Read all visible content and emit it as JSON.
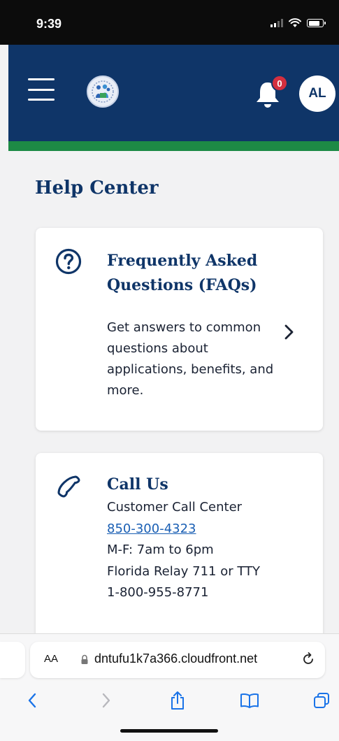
{
  "status_bar": {
    "time": "9:39"
  },
  "header": {
    "menu_icon": "hamburger-menu-icon",
    "logo_icon": "agency-seal-logo",
    "bell_icon": "bell-icon",
    "notification_count": "0",
    "avatar_initials": "AL",
    "colors": {
      "header": "#0f3568",
      "stripe": "#1d8a45",
      "badge": "#d32f3f"
    }
  },
  "page": {
    "title": "Help Center"
  },
  "faq_card": {
    "icon": "question-circle-icon",
    "title": "Frequently Asked Questions (FAQs)",
    "description": "Get answers to common questions about applications, benefits, and more.",
    "chevron_icon": "chevron-right-icon"
  },
  "call_card": {
    "icon": "phone-icon",
    "title": "Call Us",
    "subtitle": "Customer Call Center",
    "phone": "850-300-4323",
    "hours": "M-F: 7am to 6pm",
    "relay": "Florida Relay 711 or TTY",
    "tty_number": "1-800-955-8771"
  },
  "browser": {
    "text_size_label": "AA",
    "url": "dntufu1k7a366.cloudfront.net",
    "lock_icon": "lock-icon",
    "reload_icon": "reload-icon",
    "nav_icons": [
      "back-icon",
      "forward-icon",
      "share-icon",
      "bookmarks-icon",
      "tabs-icon"
    ]
  }
}
